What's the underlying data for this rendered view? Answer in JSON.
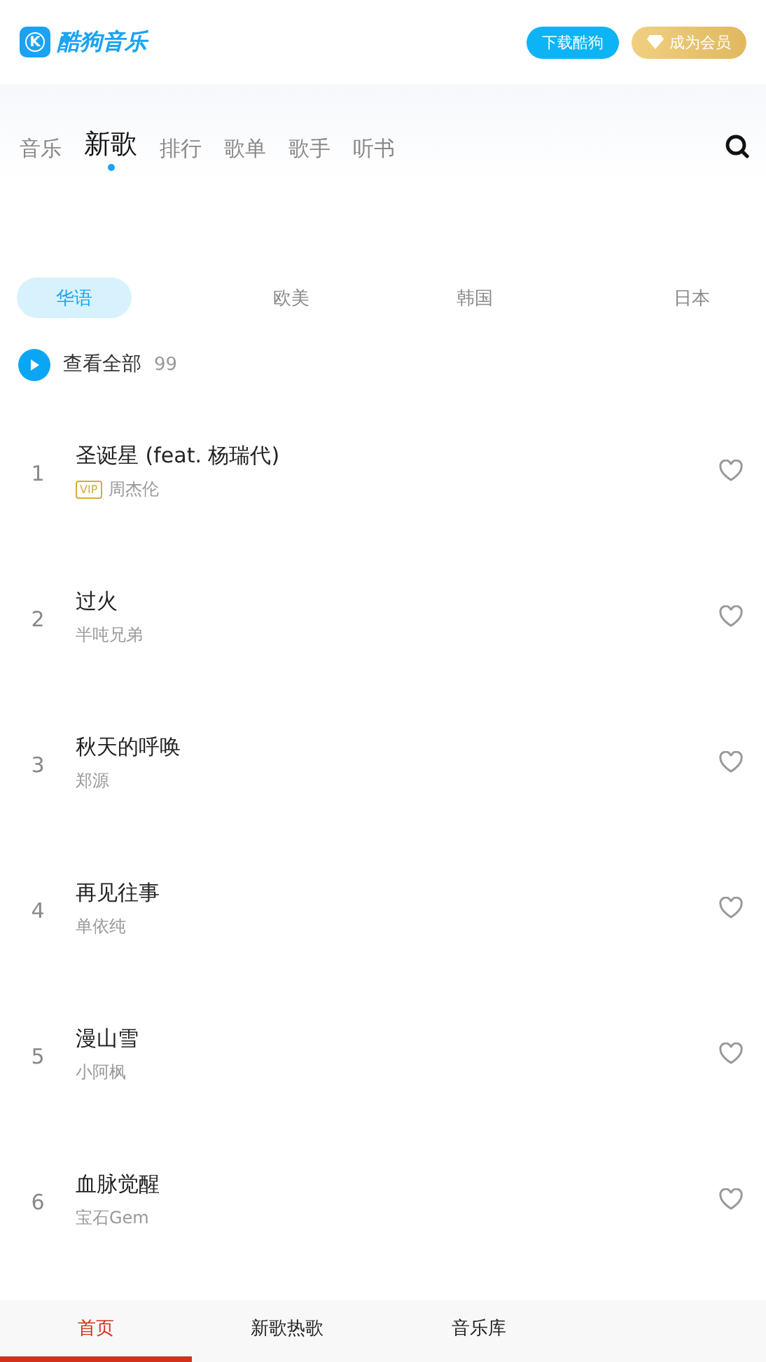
{
  "header": {
    "logo_text": "酷狗音乐",
    "logo_mark": "K",
    "buttons": [
      {
        "kind": "download",
        "label": "下载酷狗"
      },
      {
        "kind": "vip",
        "label": "成为会员"
      }
    ]
  },
  "nav_tabs": [
    {
      "label": "音乐",
      "selected": false
    },
    {
      "label": "新歌",
      "selected": true
    },
    {
      "label": "排行",
      "selected": false
    },
    {
      "label": "歌单",
      "selected": false
    },
    {
      "label": "歌手",
      "selected": false
    },
    {
      "label": "听书",
      "selected": false
    }
  ],
  "region_tabs": [
    {
      "label": "华语",
      "selected": true
    },
    {
      "label": "欧美",
      "selected": false
    },
    {
      "label": "韩国",
      "selected": false
    },
    {
      "label": "日本",
      "selected": false
    }
  ],
  "play_all": {
    "label": "查看全部",
    "count": "99"
  },
  "songs": [
    {
      "rank": "1",
      "title": "圣诞星 (feat. 杨瑞代)",
      "vip": true,
      "vip_label": "VIP",
      "artist": "周杰伦",
      "liked": false
    },
    {
      "rank": "2",
      "title": "过火",
      "vip": false,
      "artist": "半吨兄弟",
      "liked": false
    },
    {
      "rank": "3",
      "title": "秋天的呼唤",
      "vip": false,
      "artist": "郑源",
      "liked": false
    },
    {
      "rank": "4",
      "title": "再见往事",
      "vip": false,
      "artist": "单依纯",
      "liked": false
    },
    {
      "rank": "5",
      "title": "漫山雪",
      "vip": false,
      "artist": "小阿枫",
      "liked": false
    },
    {
      "rank": "6",
      "title": "血脉觉醒",
      "vip": false,
      "artist": "宝石Gem",
      "liked": false
    }
  ],
  "bottom_nav": [
    {
      "label": "首页",
      "selected": true
    },
    {
      "label": "新歌热歌",
      "selected": false
    },
    {
      "label": "音乐库",
      "selected": false
    }
  ]
}
